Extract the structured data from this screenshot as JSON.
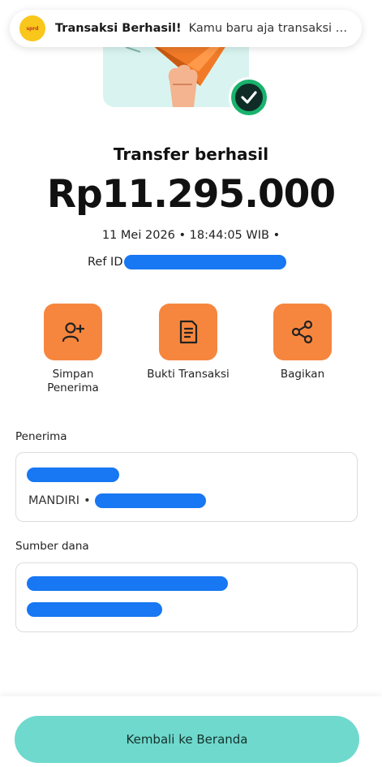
{
  "notification": {
    "title": "Transaksi Berhasil!",
    "message": "Kamu baru aja transaksi se..."
  },
  "status": {
    "title": "Transfer berhasil",
    "amount": "Rp11.295.000",
    "datetime": "11 Mei 2026 • 18:44:05 WIB •",
    "ref_label": "Ref ID"
  },
  "actions": [
    {
      "label": "Simpan\nPenerima",
      "icon": "add-person-icon"
    },
    {
      "label": "Bukti Transaksi",
      "icon": "receipt-icon"
    },
    {
      "label": "Bagikan",
      "icon": "share-icon"
    }
  ],
  "recipient": {
    "section_label": "Penerima",
    "bank": "MANDIRI"
  },
  "source": {
    "section_label": "Sumber dana"
  },
  "footer": {
    "home_button": "Kembali ke Beranda"
  },
  "colors": {
    "accent_orange": "#f6863e",
    "accent_teal": "#6fd9cd",
    "success_green": "#19b36d",
    "redaction_blue": "#1877f2"
  }
}
